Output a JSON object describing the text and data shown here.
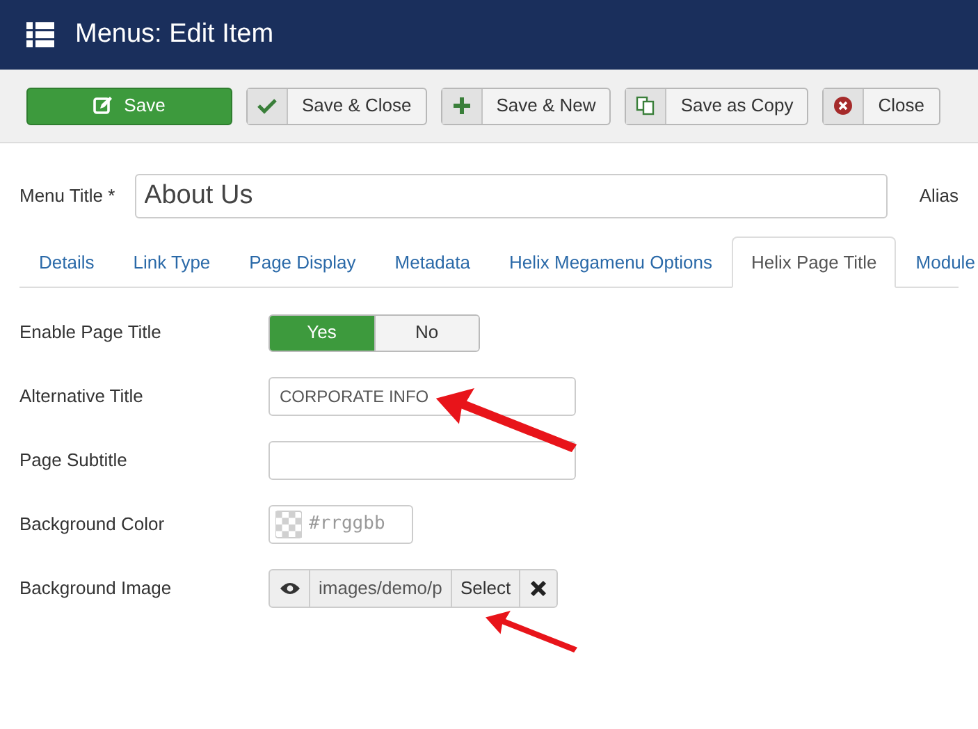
{
  "header": {
    "title": "Menus: Edit Item"
  },
  "toolbar": [
    {
      "label": "Save",
      "kind": "primary"
    },
    {
      "label": "Save & Close",
      "kind": "check"
    },
    {
      "label": "Save & New",
      "kind": "plus"
    },
    {
      "label": "Save as Copy",
      "kind": "copy"
    },
    {
      "label": "Close",
      "kind": "close"
    }
  ],
  "menu_title": {
    "label": "Menu Title *",
    "value": "About Us",
    "alias_label": "Alias"
  },
  "tabs": [
    {
      "label": "Details",
      "selected": false
    },
    {
      "label": "Link Type",
      "selected": false
    },
    {
      "label": "Page Display",
      "selected": false
    },
    {
      "label": "Metadata",
      "selected": false
    },
    {
      "label": "Helix Megamenu Options",
      "selected": false
    },
    {
      "label": "Helix Page Title",
      "selected": true
    },
    {
      "label": "Module",
      "selected": false
    }
  ],
  "fields": [
    {
      "kind": "toggle",
      "label": "Enable Page Title",
      "options": [
        {
          "label": "Yes",
          "selected": true
        },
        {
          "label": "No",
          "selected": false
        }
      ]
    },
    {
      "kind": "text",
      "label": "Alternative Title",
      "value": "CORPORATE INFO"
    },
    {
      "kind": "text",
      "label": "Page Subtitle"
    },
    {
      "kind": "color",
      "label": "Background Color",
      "placeholder": "#rrggbb"
    },
    {
      "kind": "media",
      "label": "Background Image",
      "value": "images/demo/p",
      "select": "Select"
    }
  ]
}
